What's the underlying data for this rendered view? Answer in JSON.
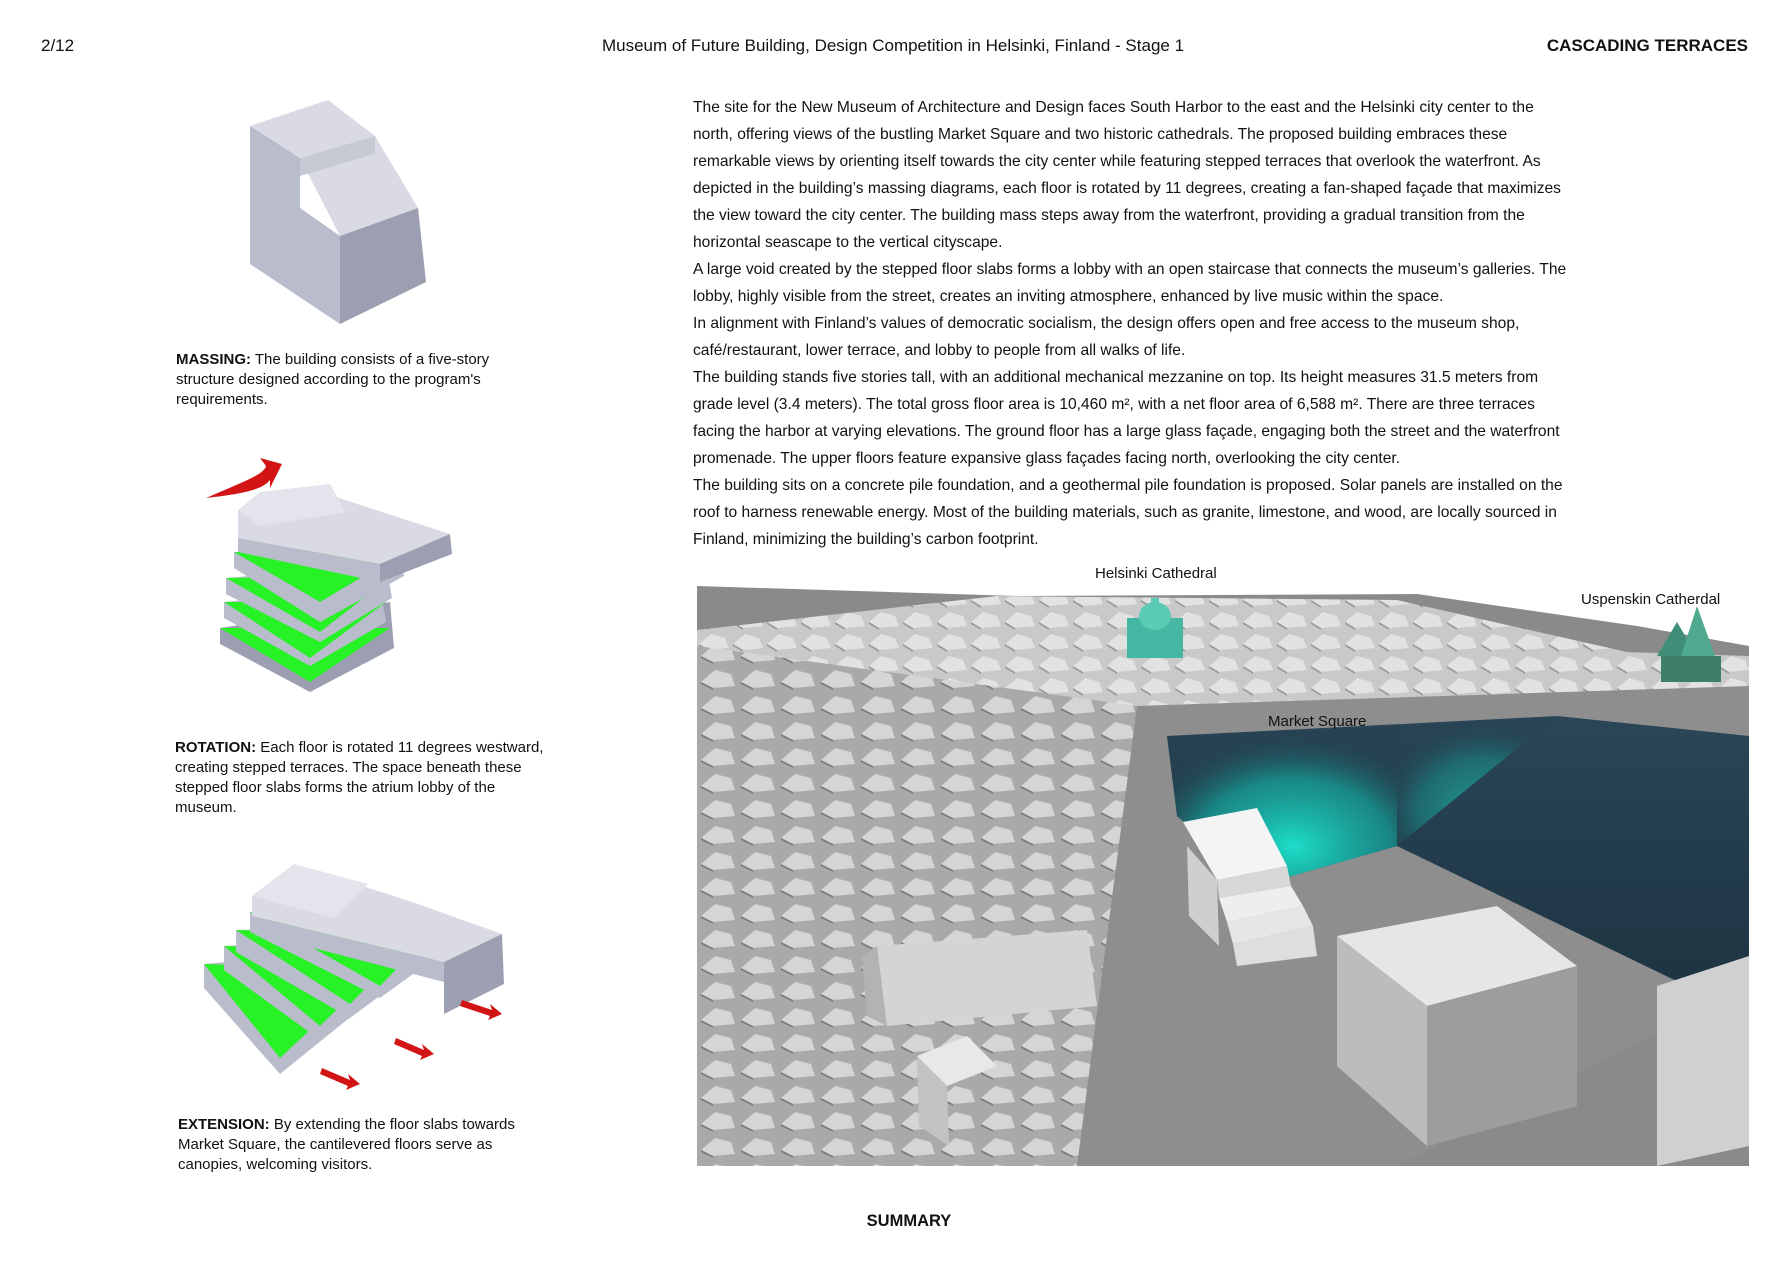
{
  "header": {
    "page_number": "2/12",
    "project_title": "Museum of Future Building, Design Competition in Helsinki, Finland - Stage 1",
    "sheet_title": "CASCADING TERRACES"
  },
  "diagrams": {
    "massing": {
      "label": "MASSING:",
      "text": " The building consists of a five-story structure designed according to the program's requirements."
    },
    "rotation": {
      "label": "ROTATION:",
      "text": " Each floor is rotated 11 degrees westward, creating stepped terraces. The space beneath these stepped floor slabs forms the atrium lobby of the museum."
    },
    "extension": {
      "label": "EXTENSION:",
      "text": "  By extending the floor slabs towards Market Square, the cantilevered floors serve as canopies, welcoming visitors."
    }
  },
  "description": {
    "paragraphs": [
      "The site for the New Museum of Architecture and Design faces South Harbor to the east and the Helsinki city center to the north, offering views of the bustling Market Square and two historic cathedrals. The proposed building embraces these remarkable views by orienting itself towards the city center while featuring stepped terraces that overlook the waterfront. As depicted in the building’s massing diagrams, each floor is rotated by 11 degrees, creating a fan-shaped façade that maximizes the view toward the city center. The building mass steps away from the waterfront, providing a gradual transition from the horizontal seascape to the vertical cityscape.",
      "A large void created by the stepped floor slabs forms a lobby with an open staircase that connects the museum’s galleries. The lobby, highly visible from the street, creates an inviting atmosphere, enhanced by live music within the space.",
      "In alignment with Finland’s values of democratic socialism, the design offers open and free access to the museum shop, café/restaurant, lower terrace, and lobby to people from all walks of life.",
      "The building stands five stories tall, with an additional mechanical mezzanine on top. Its height measures 31.5 meters from grade level (3.4 meters). The total gross floor area is 10,460 m², with a net floor area of 6,588 m². There are three terraces facing the harbor at varying elevations. The ground floor has a large glass façade, engaging both the street and the waterfront promenade. The upper floors feature expansive glass façades facing north, overlooking the city center.",
      "The building sits on a concrete pile foundation, and a geothermal pile foundation is proposed. Solar panels are installed on the roof to harness renewable energy. Most of the building materials, such as granite, limestone, and wood, are locally sourced in Finland, minimizing the building’s carbon footprint."
    ]
  },
  "site_render": {
    "labels": {
      "helsinki_cathedral": "Helsinki Cathedral",
      "uspenskin_cathedral": "Uspenskin Catherdal",
      "market_square": "Market Square"
    }
  },
  "footer": {
    "summary_title": "SUMMARY"
  },
  "colors": {
    "massing_face_top": "#d9dae3",
    "massing_face_left": "#b9bccb",
    "massing_face_right": "#9c9fb1",
    "terrace_green": "#26f226",
    "arrow_red": "#d31414",
    "water": "#243d4d",
    "highlight_cyan": "#1de6cf",
    "cathedral_teal": "#45b7a2"
  }
}
